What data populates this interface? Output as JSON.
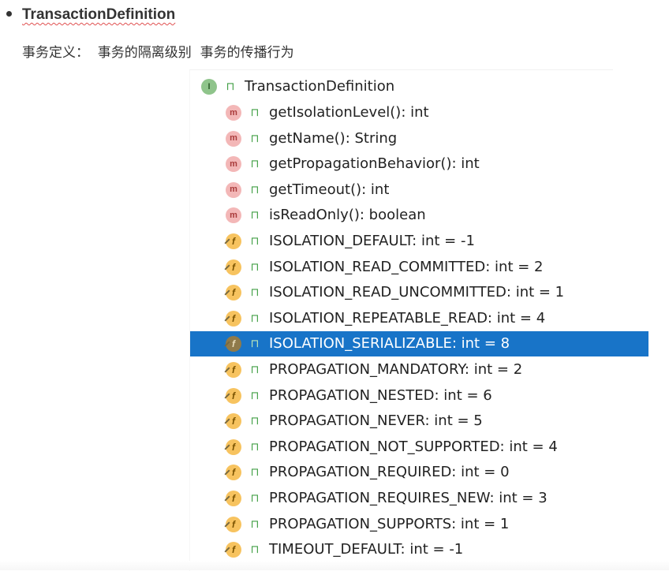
{
  "document": {
    "title": "TransactionDefinition",
    "description": "事务定义：  事务的隔离级别  事务的传播行为"
  },
  "tree": {
    "root": {
      "label": "TransactionDefinition",
      "kind_icon_name": "interface-icon",
      "kind_icon_text": "I",
      "access_icon_name": "public-access-icon"
    },
    "items": [
      {
        "label": "getIsolationLevel(): int",
        "kind": "method",
        "selected": false
      },
      {
        "label": "getName(): String",
        "kind": "method",
        "selected": false
      },
      {
        "label": "getPropagationBehavior(): int",
        "kind": "method",
        "selected": false
      },
      {
        "label": "getTimeout(): int",
        "kind": "method",
        "selected": false
      },
      {
        "label": "isReadOnly(): boolean",
        "kind": "method",
        "selected": false
      },
      {
        "label": "ISOLATION_DEFAULT: int = -1",
        "kind": "field",
        "selected": false
      },
      {
        "label": "ISOLATION_READ_COMMITTED: int = 2",
        "kind": "field",
        "selected": false
      },
      {
        "label": "ISOLATION_READ_UNCOMMITTED: int = 1",
        "kind": "field",
        "selected": false
      },
      {
        "label": "ISOLATION_REPEATABLE_READ: int = 4",
        "kind": "field",
        "selected": false
      },
      {
        "label": "ISOLATION_SERIALIZABLE: int = 8",
        "kind": "field",
        "selected": true
      },
      {
        "label": "PROPAGATION_MANDATORY: int = 2",
        "kind": "field",
        "selected": false
      },
      {
        "label": "PROPAGATION_NESTED: int = 6",
        "kind": "field",
        "selected": false
      },
      {
        "label": "PROPAGATION_NEVER: int = 5",
        "kind": "field",
        "selected": false
      },
      {
        "label": "PROPAGATION_NOT_SUPPORTED: int = 4",
        "kind": "field",
        "selected": false
      },
      {
        "label": "PROPAGATION_REQUIRED: int = 0",
        "kind": "field",
        "selected": false
      },
      {
        "label": "PROPAGATION_REQUIRES_NEW: int = 3",
        "kind": "field",
        "selected": false
      },
      {
        "label": "PROPAGATION_SUPPORTS: int = 1",
        "kind": "field",
        "selected": false
      },
      {
        "label": "TIMEOUT_DEFAULT: int = -1",
        "kind": "field",
        "selected": false
      }
    ],
    "icon_text": {
      "method": "m",
      "field": "f"
    },
    "icon_names": {
      "method": "method-icon",
      "field": "static-field-icon",
      "access": "public-access-icon"
    }
  },
  "colors": {
    "selection": "#1874c8",
    "title_text": "#333333",
    "spell_underline": "#e05050",
    "interface_icon": "#8fc48b",
    "method_icon": "#f3b7b7",
    "field_icon": "#f7c35f",
    "public_access": "#43a047"
  }
}
